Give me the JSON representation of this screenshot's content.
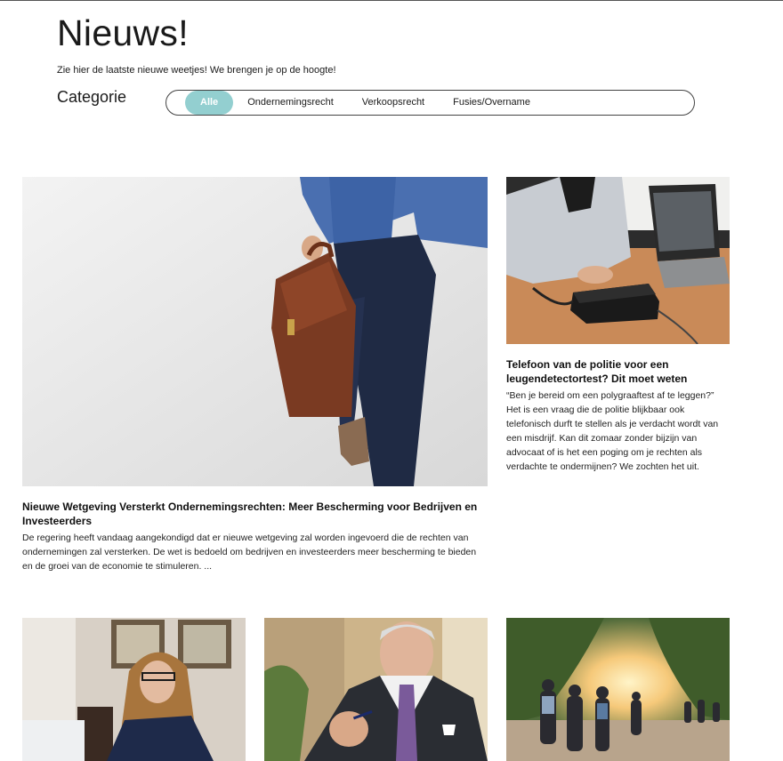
{
  "header": {
    "title": "Nieuws!",
    "subtitle": "Zie hier de laatste nieuwe weetjes! We brengen je op de hoogte!",
    "category_label": "Categorie"
  },
  "filters": [
    {
      "label": "Alle",
      "active": true
    },
    {
      "label": "Ondernemingsrecht",
      "active": false
    },
    {
      "label": "Verkoopsrecht",
      "active": false
    },
    {
      "label": "Fusies/Overname",
      "active": false
    }
  ],
  "articles": [
    {
      "image": "businessman-briefcase-photo",
      "title": "Nieuwe Wetgeving Versterkt Ondernemingsrechten: Meer Bescherming voor Bedrijven en Investeerders",
      "excerpt": "De regering heeft vandaag aangekondigd dat er nieuwe wetgeving zal worden ingevoerd die de rechten van ondernemingen zal versterken. De wet is bedoeld om bedrijven en investeerders meer bescherming te bieden en de groei van de economie te stimuleren. ..."
    },
    {
      "image": "polygraph-test-photo",
      "title": "Telefoon van de politie voor een leugendetectortest? Dit moet weten",
      "excerpt": "“Ben je bereid om een polygraaftest af te leggen?” Het is een vraag die de politie blijkbaar ook telefonisch durft te stellen als je verdacht wordt van een misdrijf. Kan dit zomaar zonder bijzijn van advocaat of is het een poging om je rechten als verdachte te ondermijnen? We zochten het uit."
    }
  ],
  "bottom_images": [
    "woman-with-glasses-photo",
    "gray-haired-man-in-suit-photo",
    "people-walking-at-sunset-photo"
  ],
  "colors": {
    "accent": "#93cfd0",
    "text": "#1a1a1a"
  }
}
